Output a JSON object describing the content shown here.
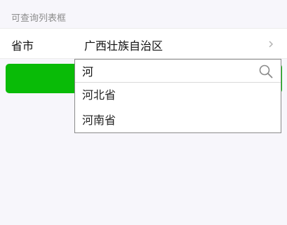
{
  "section": {
    "title": "可查询列表框"
  },
  "row": {
    "label": "省市",
    "value": "广西壮族自治区"
  },
  "dropdown": {
    "search_value": "河",
    "options": [
      {
        "label": "河北省"
      },
      {
        "label": "河南省"
      }
    ]
  },
  "colors": {
    "primary_green": "#09bb07",
    "page_background": "#f7f6fb"
  },
  "icons": {
    "chevron": "chevron-right-icon",
    "search": "search-icon"
  }
}
